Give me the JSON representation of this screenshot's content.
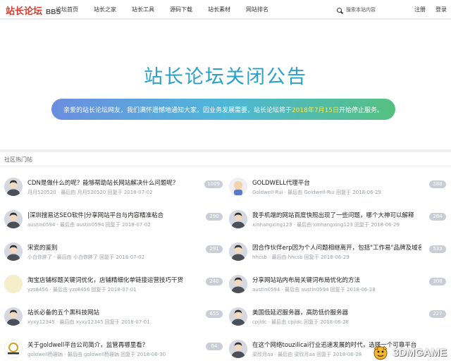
{
  "header": {
    "logo_cn": "站长论坛",
    "logo_en": "BBS",
    "nav": [
      "论坛首页",
      "站长之家",
      "站长工具",
      "源码下载",
      "站长素材",
      "网站排名"
    ],
    "search_placeholder": "搜索本站内容",
    "register": "注册",
    "login": "登录"
  },
  "banner": {
    "title": "站长论坛关闭公告",
    "notice_before": "亲爱的站长论坛网友，我们满怀遗憾地通知大家，因业务发展需要，站长论坛将于",
    "notice_date": "2018年7月15日",
    "notice_after": "开始停止服务。",
    "colors": {
      "title": "#2aa2c8",
      "pill_start": "#6b8ee0",
      "pill_end": "#54c07f",
      "date": "#ffe84a"
    }
  },
  "hot": {
    "title": "社区热门帖",
    "left": [
      {
        "title": "CDN是做什么的呢？能够帮助站长网站解决什么问题呢？",
        "meta": "月月520520 · 最后由 月月520520 回复于 2018-07-02",
        "count": "1009",
        "avatar": "person-avatar"
      },
      {
        "title": "|深圳搜易达SEO软件|分享网站平台与内容精准粘合",
        "meta": "austin0594 · 最后由 austin0594 回复于 2018-07-02",
        "count": "290",
        "avatar": "person-avatar"
      },
      {
        "title": "宋瓷的鉴别",
        "meta": "小白你胖了 · 最后由 小白你胖了 回复于 2018-07-02",
        "count": "291",
        "avatar": "person-avatar"
      },
      {
        "title": "淘宝店铺标题关键词优化，店铺精细化单链接运营技巧干货",
        "meta": "yzs8456 · 最后由 yzs8456 回复于 2018-07-01",
        "count": "240",
        "avatar": "blank-avatar"
      },
      {
        "title": "站长必备的五个黑科技网站",
        "meta": "xyxy12345 · 最后由 xyxy12345 回复于 2018-07-01",
        "count": "655",
        "avatar": "person-avatar"
      },
      {
        "title": "关于goldwell平台公司简介，监管再哪里看？",
        "meta": "goldwell杨珊钠 · 最后由 goldwell杨珊钠 回复于 2018-06-30",
        "count": "64",
        "avatar": "goldwell-logo"
      }
    ],
    "right": [
      {
        "title": "GOLDWELL代理平台",
        "meta": "Goldwell-Rui · 最后由 Goldwell-Rui 回复于 2018-06-29",
        "count": "388",
        "avatar": "cartoon-avatar"
      },
      {
        "title": "我手机端的网站百度快照出现了一些问题，哪个大神可以解释",
        "meta": "xinhangxing123 · 最后由 xinhangxing123 回复于 2018-06-29",
        "count": "284",
        "avatar": "person-avatar"
      },
      {
        "title": "因合作伙伴erp因为个人问题相继离开，包括\"工作易\"品牌及域名",
        "meta": "hhcsb · 最后由 hhcsb 回复于 2018-06-29",
        "count": "533",
        "avatar": "person-avatar"
      },
      {
        "title": "分享网站站内布局关键词布局优化的方法",
        "meta": "austin0594 · 最后由 austin0594 回复于 2018-06-28",
        "count": "308",
        "avatar": "person-avatar"
      },
      {
        "title": "美国低延迟服务器，高防低价服务器",
        "meta": "cpjidc · 最后由 cpjidc 回复于 2018-06-28",
        "count": "227",
        "avatar": "person-avatar"
      },
      {
        "title": "在这个网络touzilicai行业迅速发展的时代，选择一个可靠平台",
        "meta": "梁欣月aa · 最后由 梁欣月aa 回复于 2018-06-28",
        "count": "",
        "avatar": "person-avatar"
      }
    ]
  },
  "watermark": {
    "text": "3DMGAME",
    "icon": "mascot-icon"
  }
}
